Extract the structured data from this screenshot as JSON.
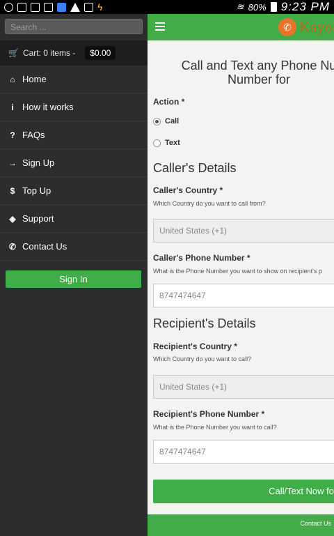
{
  "status_bar": {
    "battery": "80%",
    "time": "9:23 PM"
  },
  "drawer": {
    "search_placeholder": "Search ...",
    "cart_label": "Cart: 0 items -",
    "cart_total": "$0.00",
    "items": [
      {
        "label": "Home",
        "icon": "home-icon",
        "glyph": "⌂"
      },
      {
        "label": "How it works",
        "icon": "info-icon",
        "glyph": "i"
      },
      {
        "label": "FAQs",
        "icon": "question-icon",
        "glyph": "?"
      },
      {
        "label": "Sign Up",
        "icon": "signin-icon",
        "glyph": "→"
      },
      {
        "label": "Top Up",
        "icon": "dollar-icon",
        "glyph": "$"
      },
      {
        "label": "Support",
        "icon": "tag-icon",
        "glyph": "◈"
      },
      {
        "label": "Contact Us",
        "icon": "phone-icon",
        "glyph": "✆"
      }
    ],
    "signin_label": "Sign In"
  },
  "main": {
    "logo_text": "Kayo",
    "heading_line1": "Call and Text any Phone Nu",
    "heading_line2": "Number for",
    "action_label": "Action *",
    "action_options": [
      "Call",
      "Text"
    ],
    "action_selected": "Call",
    "callers_heading": "Caller's Details",
    "caller_country_label": "Caller's Country *",
    "caller_country_help": "Which Country do you want to call from?",
    "caller_country_value": "United States (+1)",
    "caller_phone_label": "Caller's Phone Number *",
    "caller_phone_help": "What is the Phone Number you want to show on recipient's p",
    "caller_phone_value": "8747474647",
    "recipient_heading": "Recipient's Details",
    "recipient_country_label": "Recipient's Country *",
    "recipient_country_help": "Which Country do you want to call?",
    "recipient_country_value": "United States (+1)",
    "recipient_phone_label": "Recipient's Phone Number *",
    "recipient_phone_help": "What is the Phone Number you want to call?",
    "recipient_phone_value": "8747474647",
    "submit_label": "Call/Text Now fo",
    "footer_link": "Contact Us"
  },
  "colors": {
    "accent_green": "#43ab48",
    "drawer_bg": "#2d2d2d"
  }
}
